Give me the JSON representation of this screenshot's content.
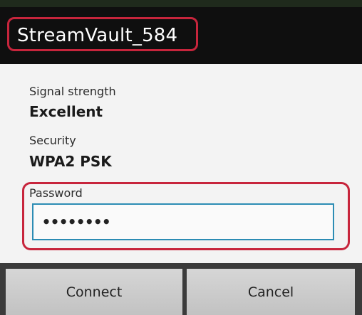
{
  "dialog": {
    "title": "StreamVault_584",
    "signal_label": "Signal strength",
    "signal_value": "Excellent",
    "security_label": "Security",
    "security_value": "WPA2 PSK",
    "password_label": "Password",
    "password_value": "11111111"
  },
  "buttons": {
    "connect": "Connect",
    "cancel": "Cancel"
  },
  "colors": {
    "highlight": "#c7253c",
    "input_border": "#2c8cb4"
  }
}
